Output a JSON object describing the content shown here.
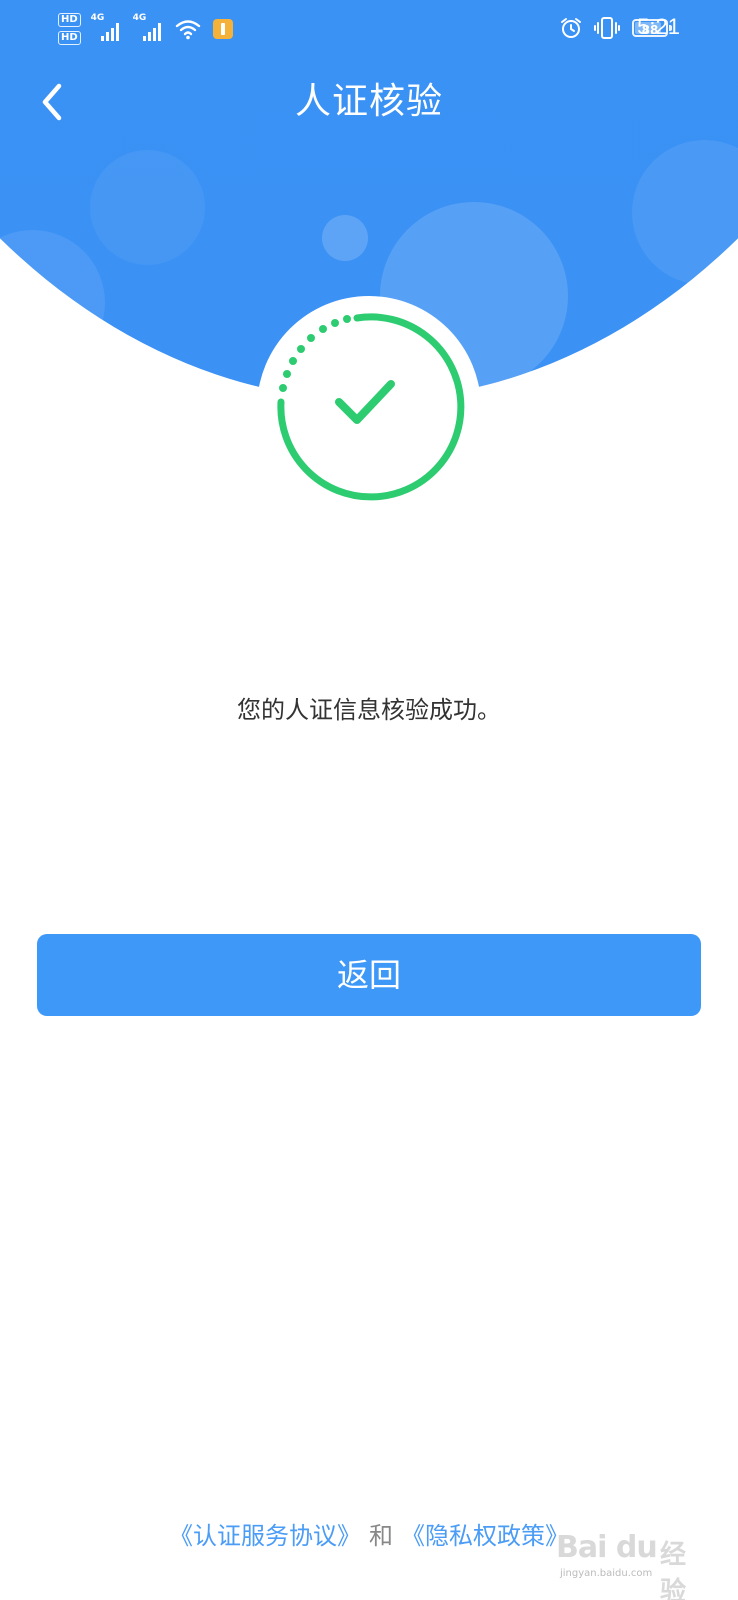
{
  "status_bar": {
    "hd1": "HD",
    "hd2": "HD",
    "sim1_net": "4G",
    "sim2_net": "4G",
    "battery": "88",
    "battery_level_percent": 88,
    "time": "5:21"
  },
  "header": {
    "title": "人证核验"
  },
  "result": {
    "message": "您的人证信息核验成功。"
  },
  "actions": {
    "back_label": "返回"
  },
  "footer": {
    "service_agreement": "《认证服务协议》",
    "conjunction": "和",
    "privacy_policy": "《隐私权政策》"
  },
  "watermark": {
    "logo": "Bai du",
    "cn": "经验",
    "sub": "jingyan.baidu.com"
  },
  "colors": {
    "primary": "#3d98f8",
    "success": "#2ecc71",
    "link": "#4a9cf6",
    "text": "#333333"
  },
  "icons": [
    "back-arrow-icon",
    "check-icon",
    "alarm-icon",
    "vibrate-icon",
    "wifi-icon",
    "signal-icon",
    "notification-icon"
  ]
}
